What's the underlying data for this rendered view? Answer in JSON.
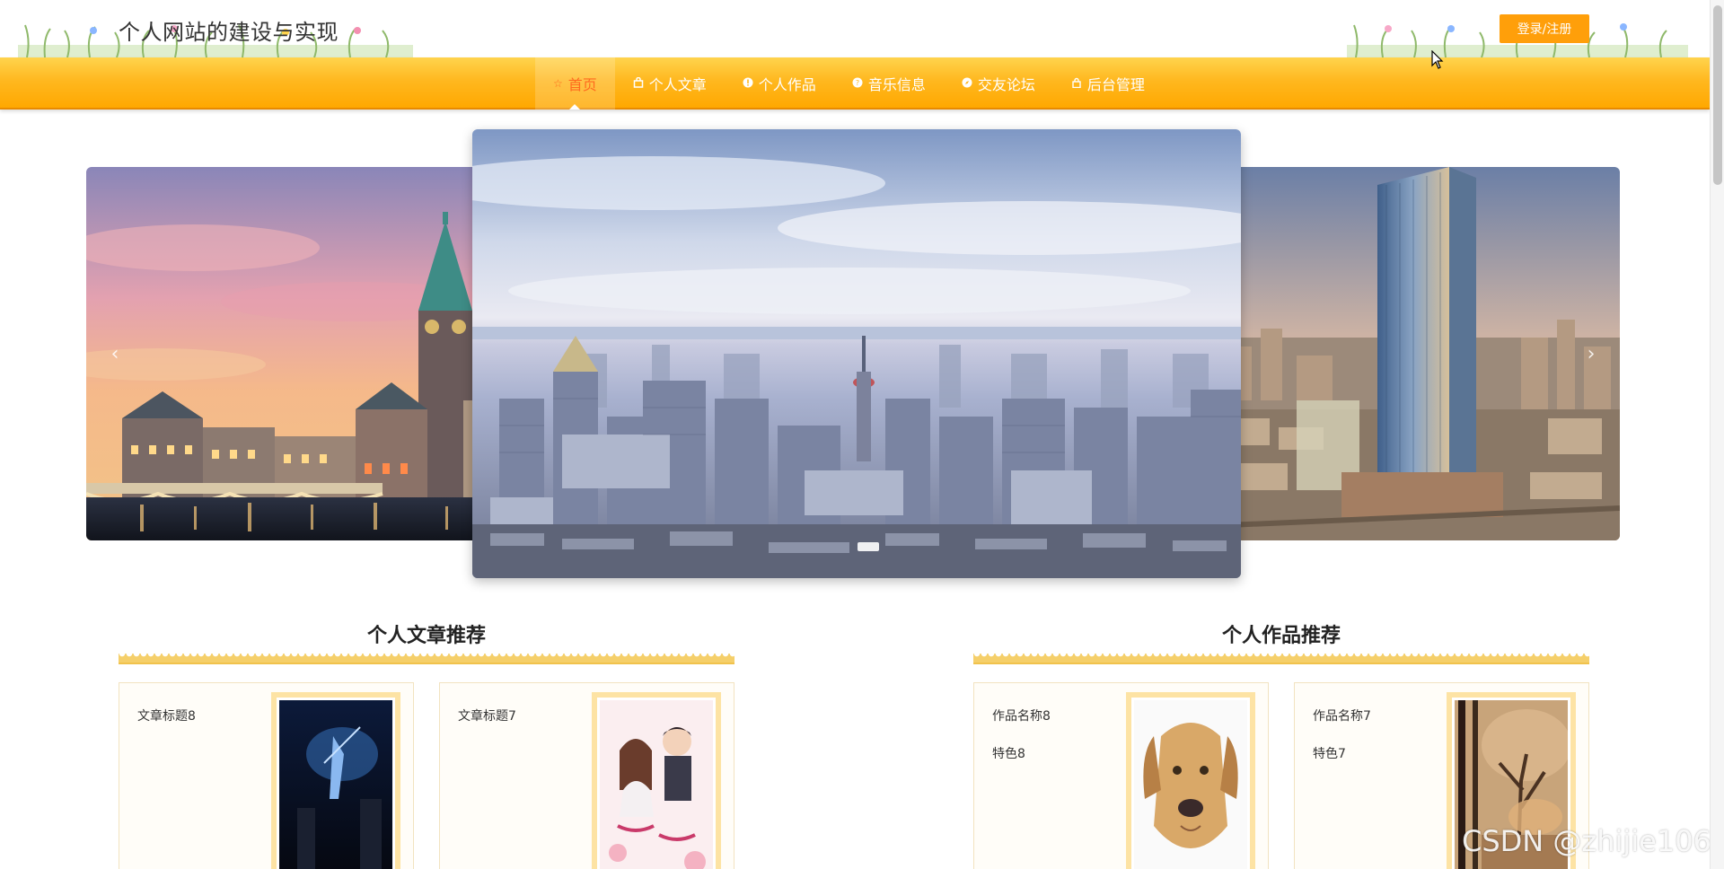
{
  "header": {
    "site_title": "个人网站的建设与实现",
    "login_label": "登录/注册"
  },
  "nav": {
    "items": [
      {
        "label": "首页",
        "icon": "star-icon",
        "active": true
      },
      {
        "label": "个人文章",
        "icon": "bag-icon",
        "active": false
      },
      {
        "label": "个人作品",
        "icon": "info-icon",
        "active": false
      },
      {
        "label": "音乐信息",
        "icon": "question-icon",
        "active": false
      },
      {
        "label": "交友论坛",
        "icon": "compass-icon",
        "active": false
      },
      {
        "label": "后台管理",
        "icon": "lock-icon",
        "active": false
      }
    ]
  },
  "carousel": {
    "prev_symbol": "‹",
    "next_symbol": "›",
    "slides": [
      {
        "scene": "old-town-church-sunset"
      },
      {
        "scene": "city-skyline-aerial"
      },
      {
        "scene": "glass-tower-dusk"
      }
    ],
    "active_index": 1
  },
  "articles": {
    "title": "个人文章推荐",
    "cards": [
      {
        "title": "文章标题8",
        "image": "book-cover-奇异人生"
      },
      {
        "title": "文章标题7",
        "image": "book-cover-一个男人的未来"
      }
    ]
  },
  "works": {
    "title": "个人作品推荐",
    "cards": [
      {
        "name": "作品名称8",
        "feature": "特色8",
        "image": "dog-photo"
      },
      {
        "name": "作品名称7",
        "feature": "特色7",
        "image": "autumn-forest-photo"
      }
    ]
  },
  "watermark": "CSDN @zhijie106",
  "colors": {
    "accent": "#ffa800",
    "button": "#ff9f0a",
    "active_nav_text": "#ff6a1e"
  }
}
